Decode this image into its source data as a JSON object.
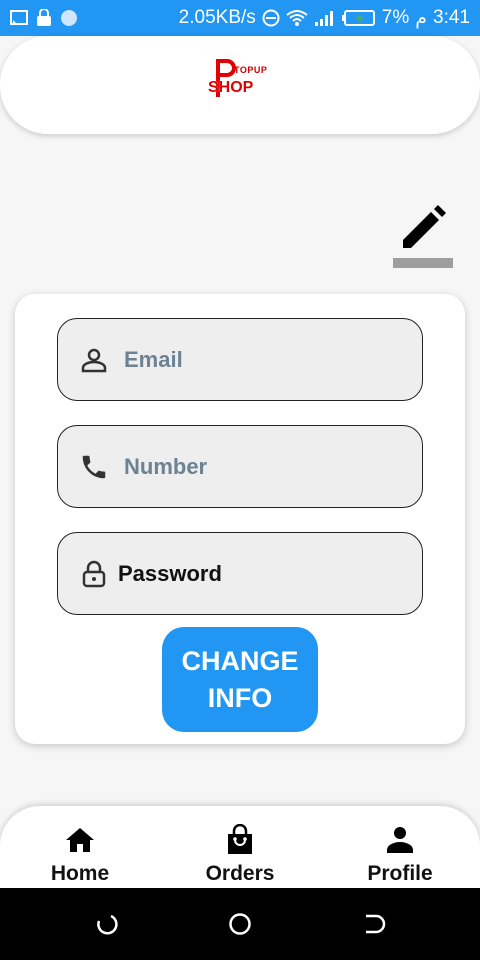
{
  "status_bar": {
    "speed": "2.05KB/s",
    "battery": "7%",
    "period": "م",
    "time": "3:41"
  },
  "logo": {
    "topup": "TOPUP",
    "shop": "SHOP"
  },
  "form": {
    "email_placeholder": "Email",
    "number_placeholder": "Number",
    "password_value": "Password",
    "change_line1": "CHANGE",
    "change_line2": "INFO"
  },
  "nav": {
    "home": "Home",
    "orders": "Orders",
    "profile": "Profile"
  },
  "icons": {
    "edit": "pencil-icon",
    "email": "person-icon",
    "number": "phone-icon",
    "password": "lock-icon",
    "home": "home-icon",
    "orders": "shopping-bag-icon",
    "profile": "person-icon"
  },
  "colors": {
    "primary": "#2196f3",
    "logo_red": "#e30000"
  }
}
